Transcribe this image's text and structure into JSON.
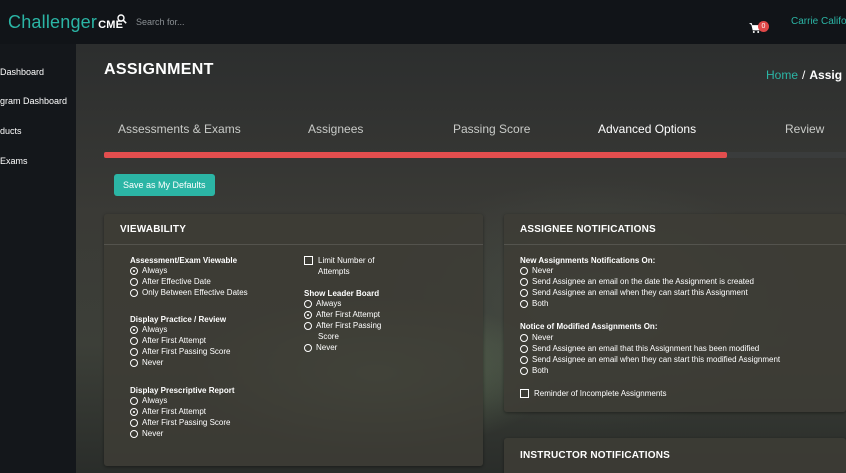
{
  "brand": {
    "name": "Challenger",
    "suffix": "CME"
  },
  "search": {
    "placeholder": "Search for..."
  },
  "cart": {
    "count": "0"
  },
  "user": {
    "name": "Carrie Califo"
  },
  "sidebar": {
    "items": [
      {
        "label": "Dashboard"
      },
      {
        "label": "gram Dashboard"
      },
      {
        "label": "ducts"
      },
      {
        "label": "Exams"
      }
    ]
  },
  "page": {
    "title": "ASSIGNMENT"
  },
  "breadcrumb": {
    "home": "Home",
    "sep": "/",
    "current": "Assig"
  },
  "tabs": [
    {
      "label": "Assessments & Exams"
    },
    {
      "label": "Assignees"
    },
    {
      "label": "Passing Score"
    },
    {
      "label": "Advanced Options"
    },
    {
      "label": "Review"
    }
  ],
  "progress": {
    "percent": 84
  },
  "defaults_button": {
    "label": "Save as My Defaults"
  },
  "viewability": {
    "title": "VIEWABILITY",
    "viewable": {
      "title": "Assessment/Exam Viewable",
      "options": [
        "Always",
        "After Effective Date",
        "Only Between Effective Dates"
      ],
      "selected": 0
    },
    "practice": {
      "title": "Display Practice / Review",
      "options": [
        "Always",
        "After First Attempt",
        "After First Passing Score",
        "Never"
      ],
      "selected": 0
    },
    "prescriptive": {
      "title": "Display Prescriptive Report",
      "options": [
        "Always",
        "After First Attempt",
        "After First Passing Score",
        "Never"
      ],
      "selected": 1
    },
    "limit": {
      "line1": "Limit Number of",
      "line2": "Attempts"
    },
    "leader": {
      "title": "Show Leader Board",
      "options": [
        "Always",
        "After First Attempt",
        "After First Passing",
        "Score",
        "Never"
      ],
      "selected": 1
    }
  },
  "assignee_notifications": {
    "title": "ASSIGNEE NOTIFICATIONS",
    "new": {
      "title": "New Assignments Notifications On:",
      "options": [
        "Never",
        "Send Assignee an email on the date the Assignment is created",
        "Send Assignee an email when they can start this Assignment",
        "Both"
      ]
    },
    "modified": {
      "title": "Notice of Modified Assignments On:",
      "options": [
        "Never",
        "Send Assignee an email that this Assignment has been modified",
        "Send Assignee an email when they can start this modified Assignment",
        "Both"
      ]
    },
    "reminder": "Reminder of Incomplete Assignments"
  },
  "instructor_notifications": {
    "title": "INSTRUCTOR NOTIFICATIONS"
  },
  "colors": {
    "accent": "#2bb5a5",
    "progress": "#e34e4e",
    "badge": "#e04848"
  }
}
